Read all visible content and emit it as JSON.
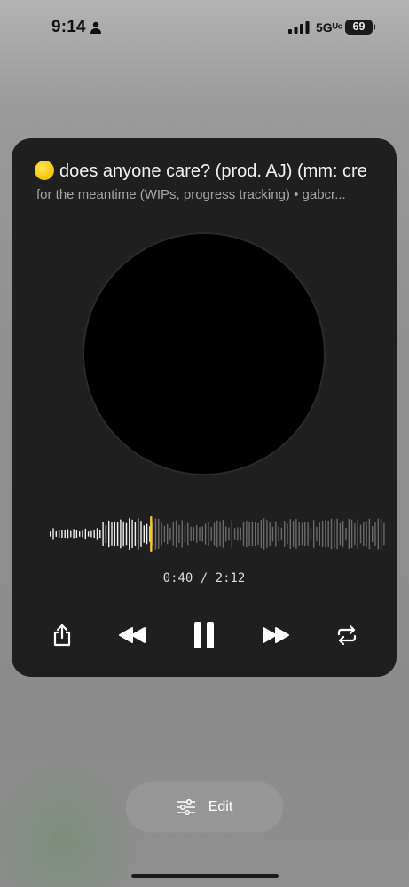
{
  "status_bar": {
    "time": "9:14",
    "network": "5Gᵁᶜ",
    "battery": "69",
    "icons": [
      "person-icon",
      "signal-bars-icon",
      "battery-icon"
    ]
  },
  "player": {
    "title_emoji": "yellow-circle-emoji",
    "title": "does anyone care? (prod. AJ) (mm: cre",
    "subtitle": "for the meantime (WIPs, progress tracking) • gabcr...",
    "elapsed": "0:40",
    "duration": "2:12",
    "time_display": "0:40 / 2:12",
    "progress": 0.303,
    "accent_color": "#f3c622",
    "controls": [
      "share-icon",
      "rewind-icon",
      "pause-icon",
      "fast-forward-icon",
      "repeat-icon"
    ]
  },
  "edit_button": {
    "label": "Edit",
    "icon": "sliders-icon"
  }
}
